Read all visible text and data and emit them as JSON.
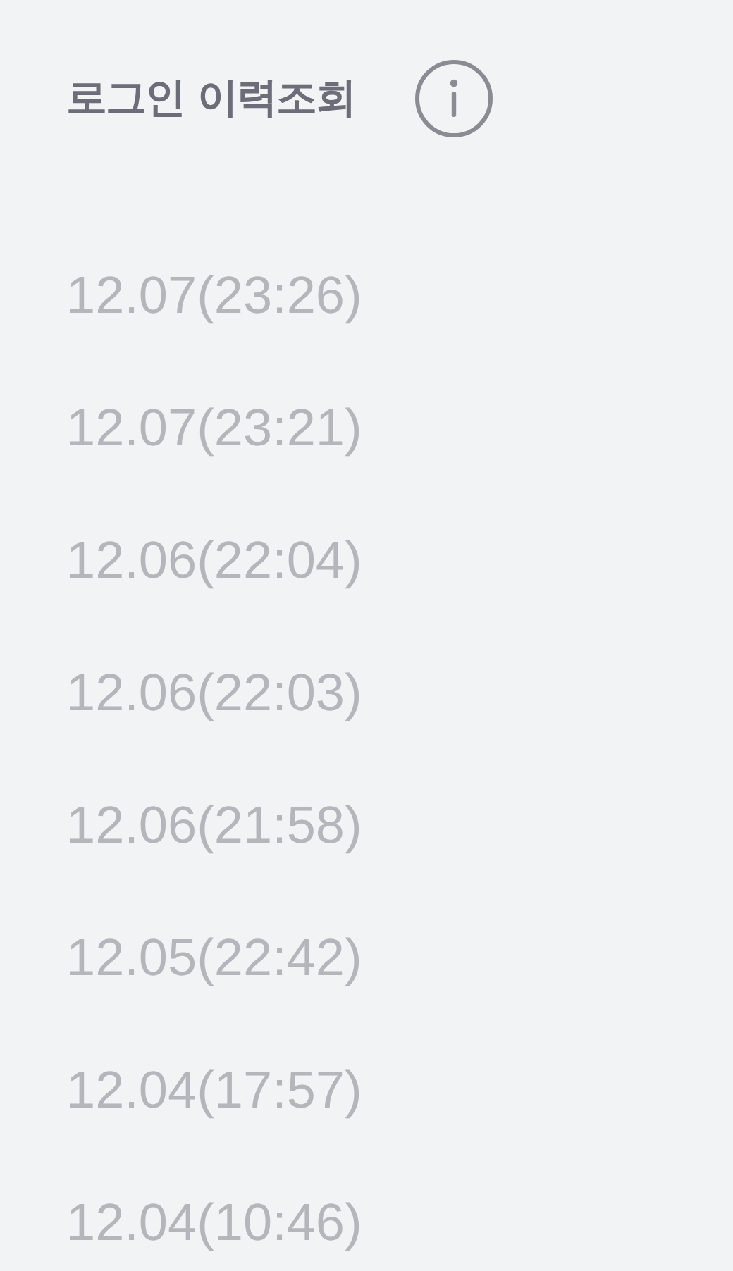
{
  "header": {
    "title": "로그인 이력조회"
  },
  "logins": [
    {
      "time": "12.07(23:26)"
    },
    {
      "time": "12.07(23:21)"
    },
    {
      "time": "12.06(22:04)"
    },
    {
      "time": "12.06(22:03)"
    },
    {
      "time": "12.06(21:58)"
    },
    {
      "time": "12.05(22:42)"
    },
    {
      "time": "12.04(17:57)"
    },
    {
      "time": "12.04(10:46)"
    }
  ]
}
